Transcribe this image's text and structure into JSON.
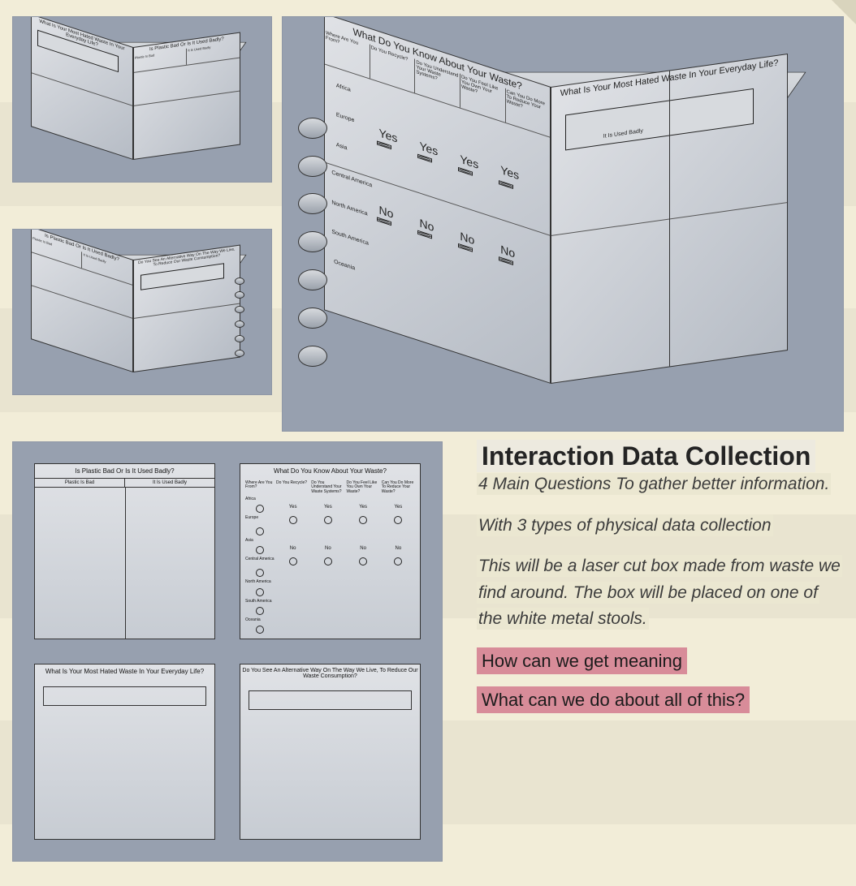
{
  "heading": "Interaction Data Collection",
  "paragraphs": {
    "p1": "4 Main Questions To gather better information.",
    "p2": "With 3 types of physical data collection",
    "p3": "This will be a laser cut box made from waste we find around. The box will be placed on one of the white metal stools."
  },
  "highlights": {
    "h1": "How can we get meaning",
    "h2": "What can we do about all of this?"
  },
  "questions": {
    "q1": "Is Plastic Bad Or Is It Used Badly?",
    "q1_opts": {
      "a": "Plastic Is Bad",
      "b": "It Is Used Badly"
    },
    "q2": "What Do You Know About Your Waste?",
    "q2_cols": {
      "c0": "Where Are You From?",
      "c1": "Do You Recycle?",
      "c2": "Do You Understand Your Waste Systems?",
      "c3": "Do You Feel Like You Own Your Waste?",
      "c4": "Can You Do More To Reduce Your Waste?"
    },
    "q2_rows": {
      "r1": "Africa",
      "r2": "Europe",
      "r3": "Asia",
      "r4": "Central America",
      "r5": "North America",
      "r6": "South America",
      "r7": "Oceania"
    },
    "yes": "Yes",
    "no": "No",
    "q3": "What Is Your Most Hated Waste In Your Everyday Life?",
    "q4": "Do You See An Alternative Way On The Way We Live, To Reduce Our Waste Consumption?"
  }
}
